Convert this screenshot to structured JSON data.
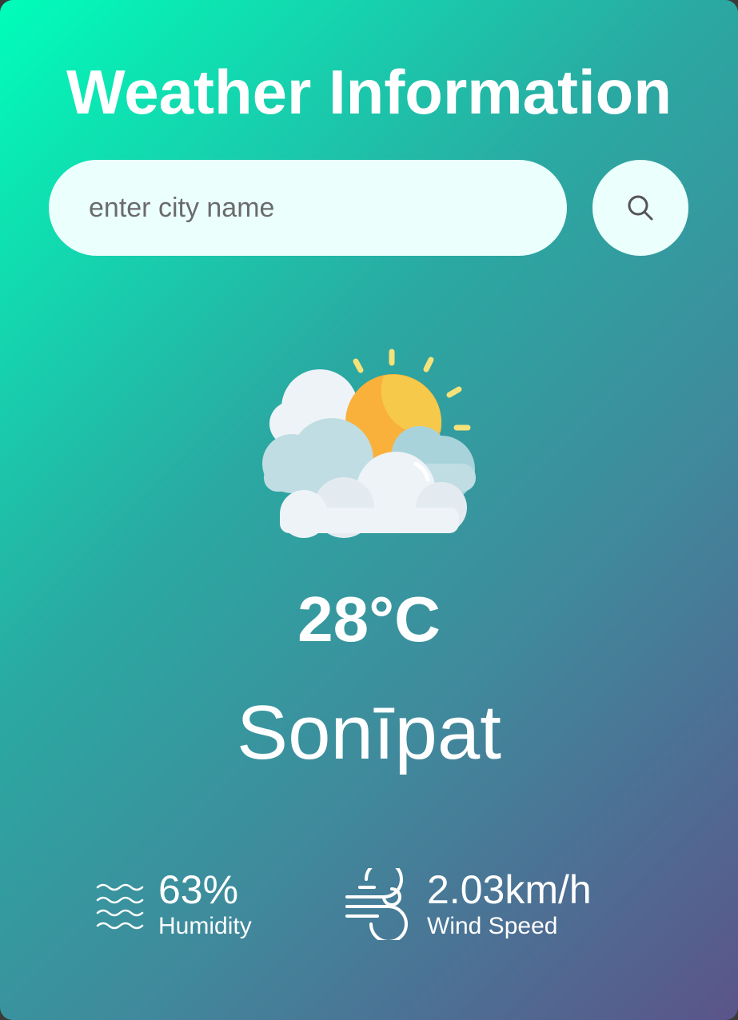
{
  "header": {
    "title": "Weather Information"
  },
  "search": {
    "placeholder": "enter city name",
    "value": ""
  },
  "weather": {
    "icon": "partly-cloudy-icon",
    "temperature": "28°C",
    "city": "Sonīpat"
  },
  "details": {
    "humidity": {
      "icon": "humidity-waves-icon",
      "value": "63%",
      "label": "Humidity"
    },
    "wind": {
      "icon": "wind-icon",
      "value": "2.03km/h",
      "label": "Wind Speed"
    }
  },
  "colors": {
    "gradient_start": "#00feba",
    "gradient_end": "#5b548a",
    "input_bg": "#ebfffc",
    "text": "#ffffff"
  }
}
